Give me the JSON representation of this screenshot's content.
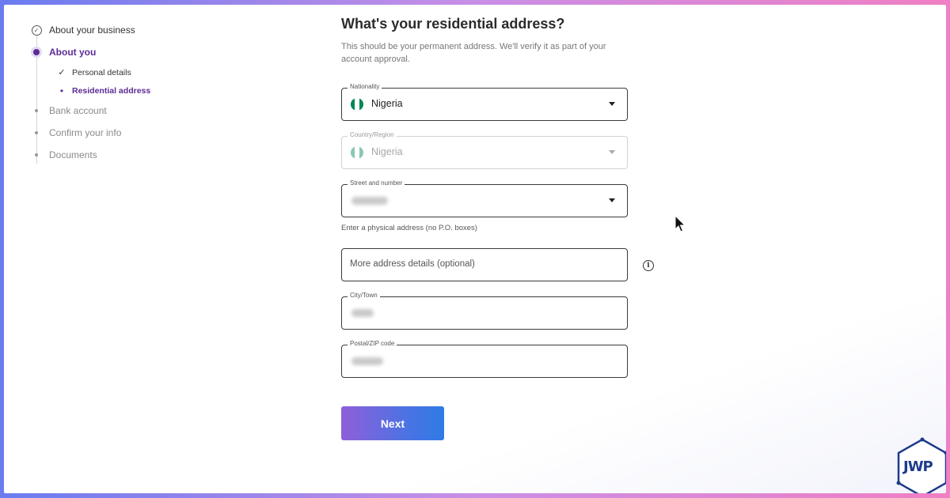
{
  "stepper": {
    "steps": [
      {
        "label": "About your business",
        "state": "done"
      },
      {
        "label": "About you",
        "state": "active"
      },
      {
        "label": "Bank account",
        "state": "pending"
      },
      {
        "label": "Confirm your info",
        "state": "pending"
      },
      {
        "label": "Documents",
        "state": "pending"
      }
    ],
    "substeps": [
      {
        "label": "Personal details",
        "icon": "check-icon"
      },
      {
        "label": "Residential address",
        "icon": "bullet-icon"
      }
    ]
  },
  "form": {
    "title": "What's your residential address?",
    "subtitle": "This should be your permanent address. We'll verify it as part of your account approval.",
    "nationality": {
      "label": "Nationality",
      "value": "Nigeria",
      "flag": "nigeria-flag-icon"
    },
    "country": {
      "label": "Country/Region",
      "value": "Nigeria",
      "flag": "nigeria-flag-icon"
    },
    "street": {
      "label": "Street and number",
      "value": ""
    },
    "street_helper": "Enter a physical address (no P.O. boxes)",
    "more_details": {
      "placeholder": "More address details (optional)"
    },
    "city": {
      "label": "City/Town",
      "value": ""
    },
    "postal": {
      "label": "Postal/ZIP code",
      "value": ""
    },
    "next_label": "Next"
  },
  "colors": {
    "accent": "#5b2b96",
    "flag_green": "#008751",
    "button_start": "#8f5fd9",
    "button_end": "#2f7be6"
  },
  "watermark": {
    "text": "JWP"
  }
}
